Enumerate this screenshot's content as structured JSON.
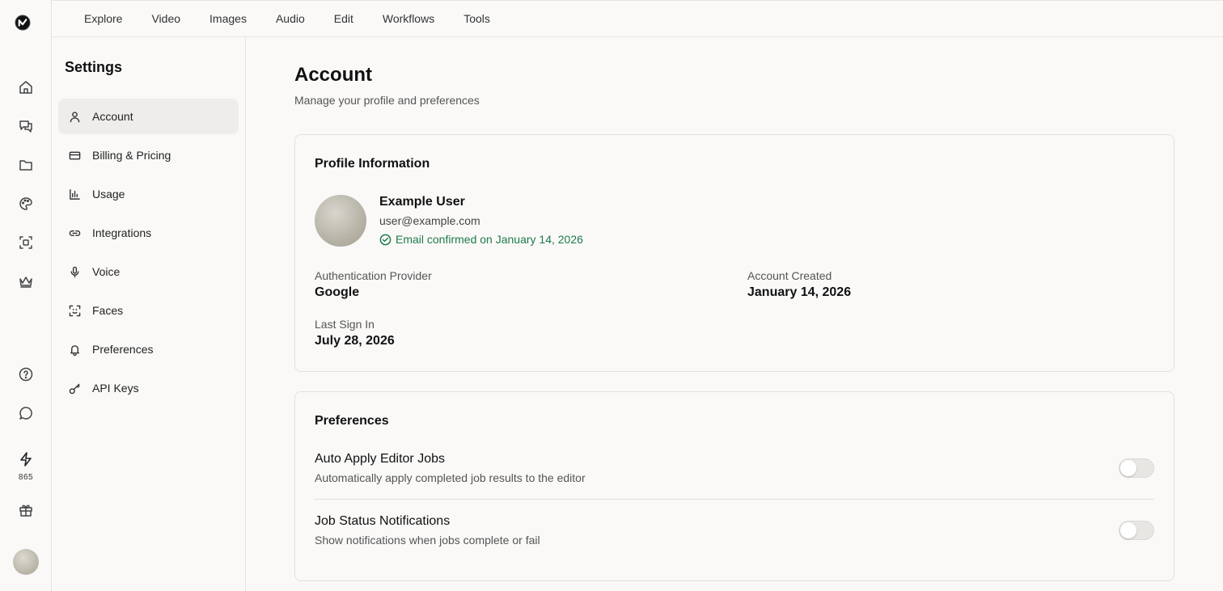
{
  "rail": {
    "logo": "brand-logo",
    "items": [
      {
        "icon": "home-icon"
      },
      {
        "icon": "chat-icon"
      },
      {
        "icon": "folder-icon"
      },
      {
        "icon": "palette-icon"
      },
      {
        "icon": "scan-icon"
      },
      {
        "icon": "crown-icon"
      }
    ],
    "bottom": [
      {
        "icon": "help-icon"
      },
      {
        "icon": "message-icon"
      }
    ],
    "credits": "865"
  },
  "topnav": {
    "items": [
      "Explore",
      "Video",
      "Images",
      "Audio",
      "Edit",
      "Workflows",
      "Tools"
    ]
  },
  "settings": {
    "title": "Settings",
    "items": [
      {
        "label": "Account",
        "icon": "user-icon"
      },
      {
        "label": "Billing & Pricing",
        "icon": "credit-card-icon"
      },
      {
        "label": "Usage",
        "icon": "bar-chart-icon"
      },
      {
        "label": "Integrations",
        "icon": "link-icon"
      },
      {
        "label": "Voice",
        "icon": "microphone-icon"
      },
      {
        "label": "Faces",
        "icon": "face-scan-icon"
      },
      {
        "label": "Preferences",
        "icon": "bell-icon"
      },
      {
        "label": "API Keys",
        "icon": "key-icon"
      }
    ],
    "active": "Account"
  },
  "page": {
    "title": "Account",
    "subtitle": "Manage your profile and preferences"
  },
  "profile": {
    "card_title": "Profile Information",
    "name": "Example User",
    "email": "user@example.com",
    "confirmed": "Email confirmed on January 14, 2026",
    "confirm_color": "#1f7a4a",
    "auth_label": "Authentication Provider",
    "auth_value": "Google",
    "created_label": "Account Created",
    "created_value": "January 14, 2026",
    "signin_label": "Last Sign In",
    "signin_value": "July 28, 2026"
  },
  "preferences": {
    "card_title": "Preferences",
    "items": [
      {
        "title": "Auto Apply Editor Jobs",
        "desc": "Automatically apply completed job results to the editor",
        "enabled": false
      },
      {
        "title": "Job Status Notifications",
        "desc": "Show notifications when jobs complete or fail",
        "enabled": false
      }
    ]
  }
}
